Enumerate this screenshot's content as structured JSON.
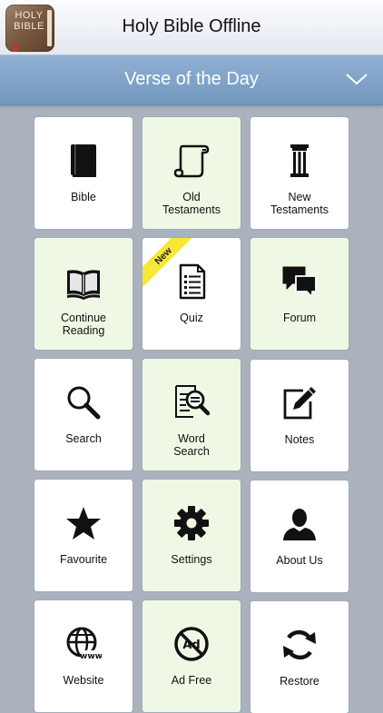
{
  "header": {
    "app_icon_text_line1": "HOLY",
    "app_icon_text_line2": "BIBLE",
    "title": "Holy Bible Offline"
  },
  "verse_of_the_day": {
    "label": "Verse of the Day",
    "toggle_icon": "chevron-down-icon"
  },
  "colors": {
    "background": "#a9b2bd",
    "tile_white": "#ffffff",
    "tile_green": "#eff8e4",
    "bar_blue": "#7fa3c9",
    "badge_yellow": "#f7e838"
  },
  "menu": {
    "bible": {
      "line1": "Bible",
      "icon": "book-icon"
    },
    "old_testaments": {
      "line1": "Old",
      "line2": "Testaments",
      "icon": "scroll-icon"
    },
    "new_testaments": {
      "line1": "New",
      "line2": "Testaments",
      "icon": "pillar-icon"
    },
    "continue_reading": {
      "line1": "Continue",
      "line2": "Reading",
      "icon": "open-book-icon"
    },
    "quiz": {
      "line1": "Quiz",
      "badge": "New",
      "icon": "document-list-icon"
    },
    "forum": {
      "line1": "Forum",
      "icon": "chat-bubbles-icon"
    },
    "search": {
      "line1": "Search",
      "icon": "magnifier-icon"
    },
    "word_search": {
      "line1": "Word",
      "line2": "Search",
      "icon": "document-search-icon"
    },
    "notes": {
      "line1": "Notes",
      "icon": "edit-note-icon"
    },
    "favourite": {
      "line1": "Favourite",
      "icon": "star-icon"
    },
    "settings": {
      "line1": "Settings",
      "icon": "gear-icon"
    },
    "about_us": {
      "line1": "About Us",
      "icon": "person-icon"
    },
    "website": {
      "line1": "Website",
      "icon": "globe-www-icon"
    },
    "ad_free": {
      "line1": "Ad Free",
      "icon": "no-ad-icon"
    },
    "restore": {
      "line1": "Restore",
      "icon": "refresh-icon"
    }
  }
}
